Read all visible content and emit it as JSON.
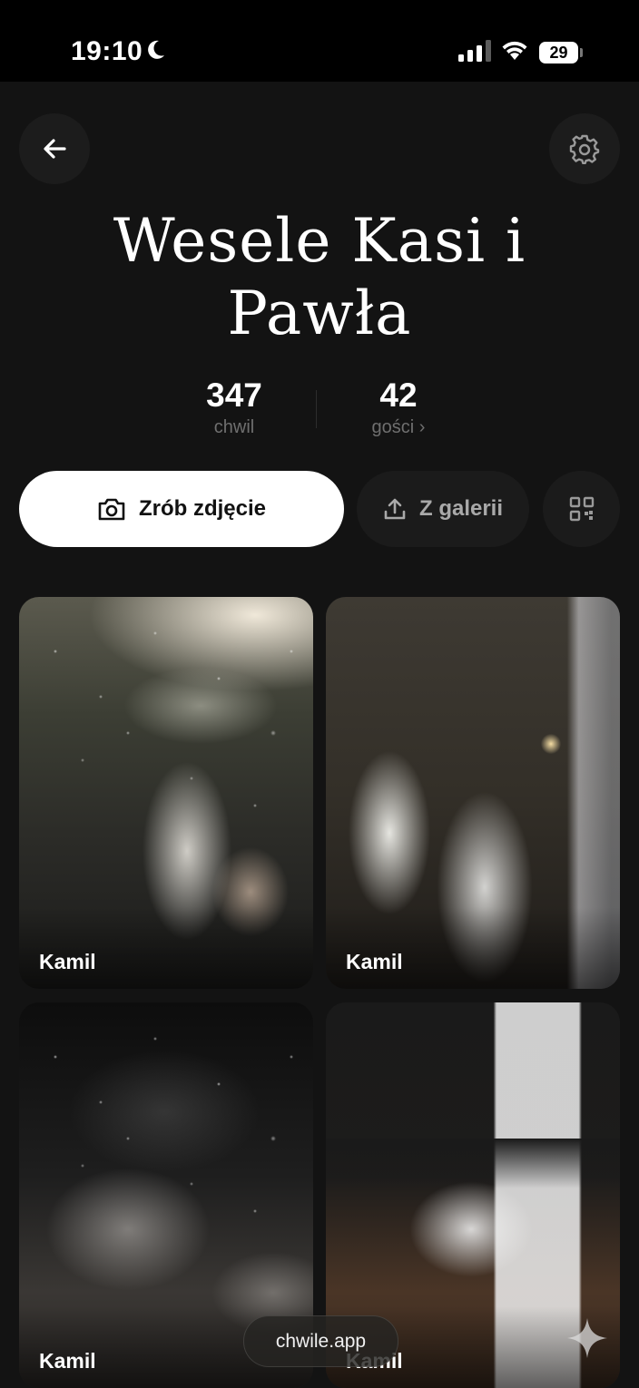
{
  "status_bar": {
    "time": "19:10",
    "battery": "29"
  },
  "header": {
    "back_icon": "arrow-left-icon",
    "settings_icon": "gear-icon"
  },
  "event": {
    "title": "Wesele Kasi i Pawła"
  },
  "stats": {
    "moments_count": "347",
    "moments_label": "chwil",
    "guests_count": "42",
    "guests_label": "gości ›"
  },
  "actions": {
    "camera_label": "Zrób zdjęcie",
    "camera_icon": "camera-icon",
    "gallery_label": "Z galerii",
    "gallery_icon": "upload-icon",
    "qr_icon": "qr-code-icon"
  },
  "photos": [
    {
      "author": "Kamil"
    },
    {
      "author": "Kamil"
    },
    {
      "author": "Kamil"
    },
    {
      "author": "Kamil"
    }
  ],
  "footer": {
    "domain": "chwile.app"
  },
  "colors": {
    "background": "#131313",
    "surface": "#1c1c1c",
    "primary_button": "#ffffff",
    "muted_text": "#6f6f6f"
  }
}
